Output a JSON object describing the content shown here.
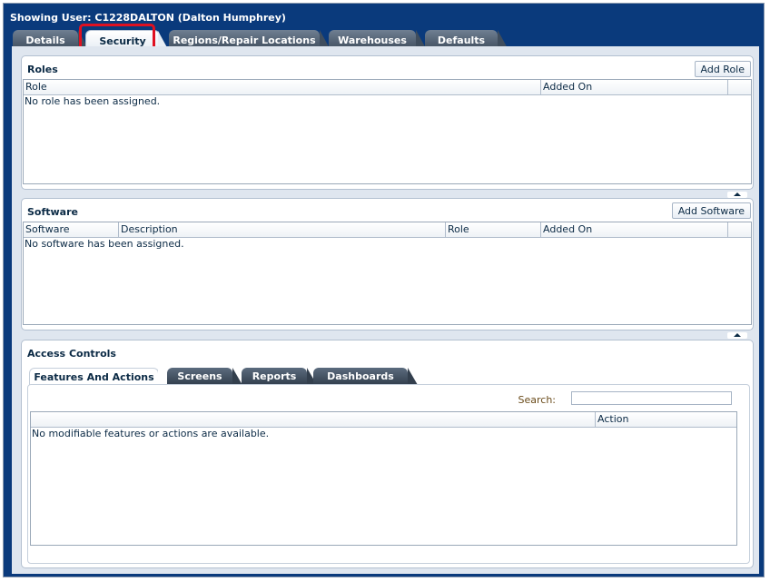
{
  "header": {
    "title": "Showing User: C1228DALTON (Dalton Humphrey)"
  },
  "tabs": [
    {
      "label": "Details"
    },
    {
      "label": "Security"
    },
    {
      "label": "Regions/Repair Locations"
    },
    {
      "label": "Warehouses"
    },
    {
      "label": "Defaults"
    }
  ],
  "active_tab": "Security",
  "roles": {
    "title": "Roles",
    "add_button": "Add Role",
    "columns": [
      "Role",
      "Added On"
    ],
    "empty_message": "No role has been assigned."
  },
  "software": {
    "title": "Software",
    "add_button": "Add Software",
    "columns": [
      "Software",
      "Description",
      "Role",
      "Added On"
    ],
    "empty_message": "No software has been assigned."
  },
  "access_controls": {
    "title": "Access Controls",
    "tabs": [
      {
        "label": "Features And Actions"
      },
      {
        "label": "Screens"
      },
      {
        "label": "Reports"
      },
      {
        "label": "Dashboards"
      }
    ],
    "active_tab": "Features And Actions",
    "search_label": "Search:",
    "search_value": "",
    "columns": [
      "",
      "Action"
    ],
    "empty_message": "No modifiable features or actions are available."
  },
  "colors": {
    "header_bg": "#0a3a7c",
    "highlight": "#e01020"
  }
}
